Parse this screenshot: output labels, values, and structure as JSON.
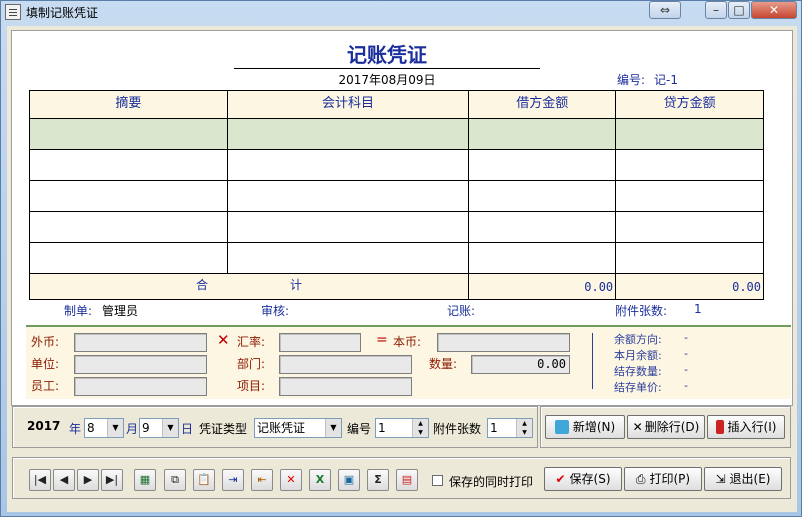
{
  "window": {
    "title": "填制记账凭证",
    "btn_restore": "⇔",
    "btn_min": "–",
    "btn_max": "□",
    "btn_close": "✕"
  },
  "voucher": {
    "title": "记账凭证",
    "date": "2017年08月09日",
    "number_label": "编号:",
    "number": "记-1",
    "columns": [
      "摘要",
      "会计科目",
      "借方金额",
      "贷方金额"
    ],
    "rows": [
      [
        "",
        "",
        "",
        ""
      ],
      [
        "",
        "",
        "",
        ""
      ],
      [
        "",
        "",
        "",
        ""
      ],
      [
        "",
        "",
        "",
        ""
      ],
      [
        "",
        "",
        "",
        ""
      ]
    ],
    "total_label_1": "合",
    "total_label_2": "计",
    "total_debit": "0.00",
    "total_credit": "0.00"
  },
  "signatures": {
    "maker_label": "制单:",
    "maker": "管理员",
    "reviewer_label": "审核:",
    "bookkeeper_label": "记账:",
    "attach_label": "附件张数:",
    "attach_count": "1"
  },
  "info": {
    "currency_label": "外币:",
    "rate_label": "汇率:",
    "base_label": "本币:",
    "unit_label": "单位:",
    "dept_label": "部门:",
    "qty_label": "数量:",
    "qty_value": "0.00",
    "staff_label": "员工:",
    "project_label": "项目:",
    "balance_dir_label": "余额方向:",
    "balance_dir": "-",
    "month_balance_label": "本月余额:",
    "month_balance": "-",
    "stock_qty_label": "结存数量:",
    "stock_qty": "-",
    "stock_price_label": "结存单价:",
    "stock_price": "-"
  },
  "controls": {
    "year": "2017",
    "year_label": "年",
    "month": "8",
    "month_label": "月",
    "day": "9",
    "day_label": "日",
    "type_label": "凭证类型",
    "type": "记账凭证",
    "number_label": "编号",
    "number": "1",
    "attach_label": "附件张数",
    "attach": "1",
    "add_btn": "新增(N)",
    "delete_row_btn": "删除行(D)",
    "insert_row_btn": "插入行(I)",
    "print_on_save_label": "保存的同时打印",
    "save_btn": "保存(S)",
    "print_btn": "打印(P)",
    "exit_btn": "退出(E)"
  },
  "toolbar_icons": [
    "first-record-icon",
    "prev-record-icon",
    "next-record-icon",
    "last-record-icon",
    "calculator-icon",
    "copy-icon",
    "paste-icon",
    "import-icon",
    "export-icon",
    "delete-icon",
    "excel-icon",
    "save-template-icon",
    "sum-icon",
    "detail-icon"
  ],
  "colors": {
    "accent_blue": "#1a2f9c",
    "label_red": "#8b1a00",
    "header_bg": "#fdf6e2",
    "selected_row": "#dbe6cf"
  }
}
